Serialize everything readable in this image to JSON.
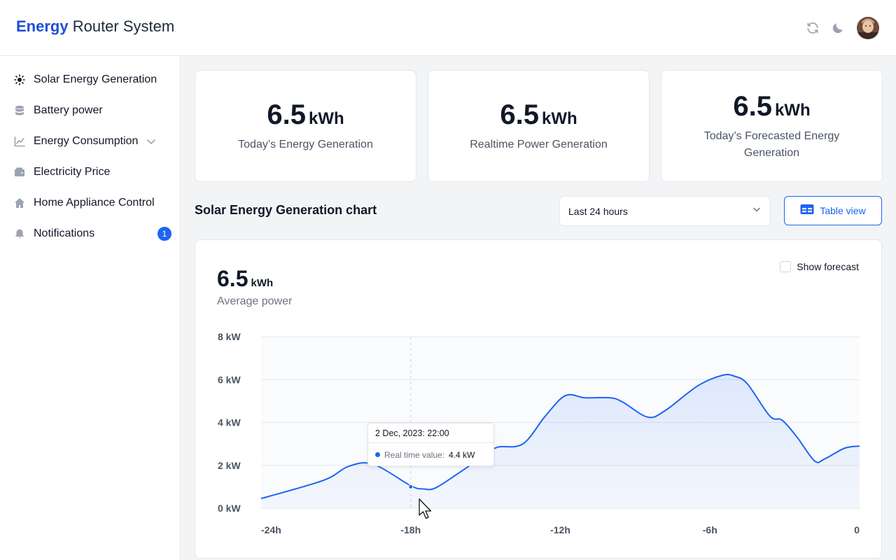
{
  "header": {
    "brand_bold": "Energy",
    "brand_rest": " Router System",
    "icons": [
      "refresh-icon",
      "moon-icon",
      "avatar"
    ]
  },
  "sidebar": {
    "items": [
      {
        "label": "Solar Energy Generation",
        "icon": "sun-icon"
      },
      {
        "label": "Battery power",
        "icon": "database-icon"
      },
      {
        "label": "Energy Consumption",
        "icon": "chart-line-icon",
        "expandable": true
      },
      {
        "label": "Electricity Price",
        "icon": "wallet-icon"
      },
      {
        "label": "Home Appliance Control",
        "icon": "home-icon"
      },
      {
        "label": "Notifications",
        "icon": "bell-icon",
        "badge": "1"
      }
    ]
  },
  "stats": [
    {
      "value": "6.5",
      "unit": "kWh",
      "label": "Today’s Energy Generation"
    },
    {
      "value": "6.5",
      "unit": "kWh",
      "label": "Realtime Power Generation"
    },
    {
      "value": "6.5",
      "unit": "kWh",
      "label": "Today’s Forecasted Energy Generation"
    }
  ],
  "chart_section": {
    "title": "Solar Energy Generation chart",
    "range": "Last 24 hours",
    "table_view_label": "Table view",
    "average": {
      "value": "6.5",
      "unit": "kWh",
      "label": "Average power"
    },
    "show_forecast_label": "Show forecast",
    "show_forecast_checked": false,
    "tooltip": {
      "title": "2 Dec, 2023: 22:00",
      "key": "Real time value:",
      "value": "4.4 kW"
    }
  },
  "colors": {
    "accent": "#1d64f2",
    "brand": "#1d4ed8"
  },
  "chart_data": {
    "type": "area",
    "ylabel": "",
    "xlabel": "",
    "ylim": [
      0,
      8
    ],
    "yticks": [
      "8 kW",
      "6 kW",
      "4 kW",
      "2 kW",
      "0 kW"
    ],
    "xlim": [
      -24,
      0
    ],
    "xticks": [
      {
        "value": -24,
        "label": "-24h"
      },
      {
        "value": -18,
        "label": "-18h"
      },
      {
        "value": -12,
        "label": "-12h"
      },
      {
        "value": -6,
        "label": "-6h"
      },
      {
        "value": 0,
        "label": "0"
      }
    ],
    "series": [
      {
        "x": [
          -24,
          -21.5,
          -20.5,
          -19.5,
          -18,
          -17.5,
          -17,
          -16,
          -15,
          -14.5,
          -13.5,
          -12.6,
          -11.8,
          -11,
          -10,
          -9.5,
          -8.5,
          -7.8,
          -6.5,
          -5.5,
          -5,
          -4.5,
          -3.6,
          -3.1,
          -2.5,
          -1.8,
          -1.4,
          -0.6,
          0
        ],
        "y": [
          0.45,
          1.3,
          1.95,
          2.05,
          1.05,
          0.9,
          0.95,
          1.7,
          2.5,
          2.85,
          3.0,
          4.3,
          5.25,
          5.15,
          5.15,
          4.95,
          4.25,
          4.55,
          5.7,
          6.2,
          6.15,
          5.8,
          4.3,
          4.1,
          3.3,
          2.2,
          2.3,
          2.8,
          2.9
        ]
      }
    ],
    "highlight": {
      "x": -18,
      "y": 1.0
    },
    "grid": true,
    "legend": "none"
  }
}
